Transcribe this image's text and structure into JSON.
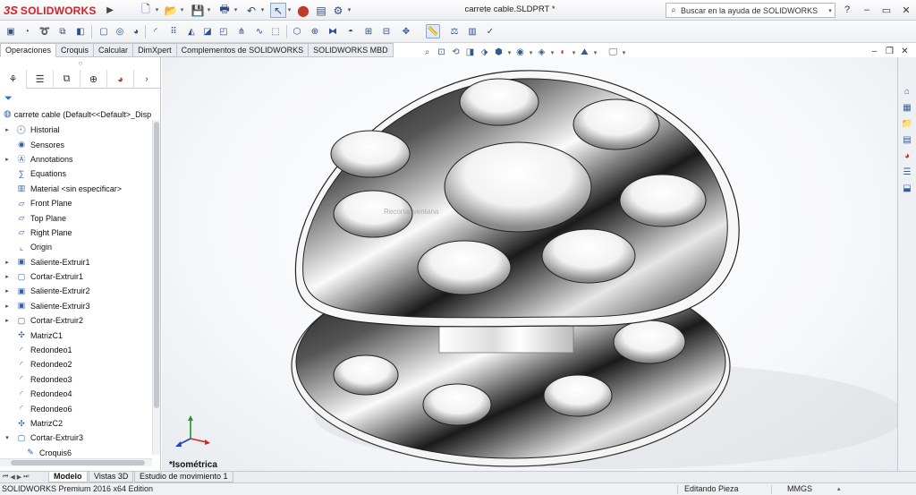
{
  "app": {
    "brand_prefix": "3S",
    "brand_name": "SOLIDWORKS",
    "document_title": "carrete cable.SLDPRT *"
  },
  "help_search": {
    "placeholder": "Buscar en la ayuda de SOLIDWORKS"
  },
  "window_controls": [
    "?",
    "–",
    "▭",
    "✕"
  ],
  "command_tabs": [
    {
      "label": "Operaciones",
      "active": true
    },
    {
      "label": "Croquis",
      "active": false
    },
    {
      "label": "Calcular",
      "active": false
    },
    {
      "label": "DimXpert",
      "active": false
    },
    {
      "label": "Complementos de SOLIDWORKS",
      "active": false
    },
    {
      "label": "SOLIDWORKS MBD",
      "active": false
    }
  ],
  "feature_tree": {
    "root": "carrete cable  (Default<<Default>_Disp",
    "items": [
      {
        "label": "Historial",
        "icon": "history-icon",
        "expand": "▸"
      },
      {
        "label": "Sensores",
        "icon": "sensor-icon",
        "expand": ""
      },
      {
        "label": "Annotations",
        "icon": "annotations-icon",
        "expand": "▸"
      },
      {
        "label": "Equations",
        "icon": "equations-icon",
        "expand": ""
      },
      {
        "label": "Material <sin especificar>",
        "icon": "material-icon",
        "expand": ""
      },
      {
        "label": "Front Plane",
        "icon": "plane-icon",
        "expand": ""
      },
      {
        "label": "Top Plane",
        "icon": "plane-icon",
        "expand": ""
      },
      {
        "label": "Right Plane",
        "icon": "plane-icon",
        "expand": ""
      },
      {
        "label": "Origin",
        "icon": "origin-icon",
        "expand": ""
      },
      {
        "label": "Saliente-Extruir1",
        "icon": "extrude-boss-icon",
        "expand": "▸"
      },
      {
        "label": "Cortar-Extruir1",
        "icon": "extrude-cut-icon",
        "expand": "▸"
      },
      {
        "label": "Saliente-Extruir2",
        "icon": "extrude-boss-icon",
        "expand": "▸"
      },
      {
        "label": "Saliente-Extruir3",
        "icon": "extrude-boss-icon",
        "expand": "▸"
      },
      {
        "label": "Cortar-Extruir2",
        "icon": "extrude-cut-icon",
        "expand": "▸"
      },
      {
        "label": "MatrizC1",
        "icon": "circular-pattern-icon",
        "expand": ""
      },
      {
        "label": "Redondeo1",
        "icon": "fillet-icon",
        "expand": ""
      },
      {
        "label": "Redondeo2",
        "icon": "fillet-icon",
        "expand": ""
      },
      {
        "label": "Redondeo3",
        "icon": "fillet-icon",
        "expand": ""
      },
      {
        "label": "Redondeo4",
        "icon": "fillet-icon",
        "expand": ""
      },
      {
        "label": "Redondeo6",
        "icon": "fillet-icon",
        "expand": ""
      },
      {
        "label": "MatrizC2",
        "icon": "circular-pattern-icon",
        "expand": ""
      },
      {
        "label": "Cortar-Extruir3",
        "icon": "extrude-cut-icon",
        "expand": "▾"
      },
      {
        "label": "Croquis6",
        "icon": "sketch-icon",
        "expand": "",
        "child": true
      }
    ]
  },
  "viewport": {
    "ghost_tooltip": "Recortar ventana",
    "view_label": "*Isométrica",
    "background": "#f7f8fa"
  },
  "bottom_tabs": [
    {
      "label": "Modelo",
      "active": true
    },
    {
      "label": "Vistas 3D",
      "active": false
    },
    {
      "label": "Estudio de movimiento 1",
      "active": false
    }
  ],
  "status_bar": {
    "edition": "SOLIDWORKS Premium 2016 x64 Edition",
    "mode": "Editando Pieza",
    "units": "MMGS"
  },
  "colors": {
    "brand": "#d62027",
    "accent": "#2e5f9e"
  }
}
